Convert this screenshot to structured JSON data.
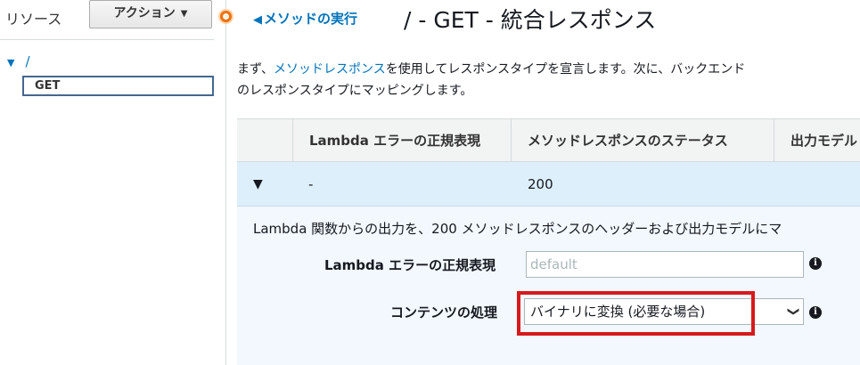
{
  "sidebar": {
    "title": "リソース",
    "action_label": "アクション",
    "tree": {
      "root_label": "/",
      "selected_method": "GET"
    }
  },
  "header": {
    "back_link": "メソッドの実行",
    "title": "/ - GET - 統合レスポンス"
  },
  "description": {
    "prefix": "まず、",
    "link": "メソッドレスポンス",
    "line1_rest": "を使用してレスポンスタイプを宣言します。次に、バックエンド",
    "line2": "のレスポンスタイプにマッピングします。"
  },
  "table": {
    "columns": [
      "Lambda エラーの正規表現",
      "メソッドレスポンスのステータス",
      "出力モデル"
    ],
    "rows": [
      {
        "regex": "-",
        "status": "200"
      }
    ]
  },
  "detail": {
    "text": "Lambda 関数からの出力を、200 メソッドレスポンスのヘッダーおよび出力モデルにマ",
    "regex_label": "Lambda エラーの正規表現",
    "regex_placeholder": "default",
    "content_label": "コンテンツの処理",
    "content_value": "バイナリに変換 (必要な場合)"
  },
  "icons": {
    "back": "arrow-left-icon",
    "expand": "triangle-down-icon",
    "info": "info-icon",
    "dropdown": "chevron-down-icon"
  },
  "colors": {
    "link": "#0073bb",
    "highlight": "#d7191c",
    "row_selected": "#ddeffb",
    "accent": "#ec7211"
  }
}
